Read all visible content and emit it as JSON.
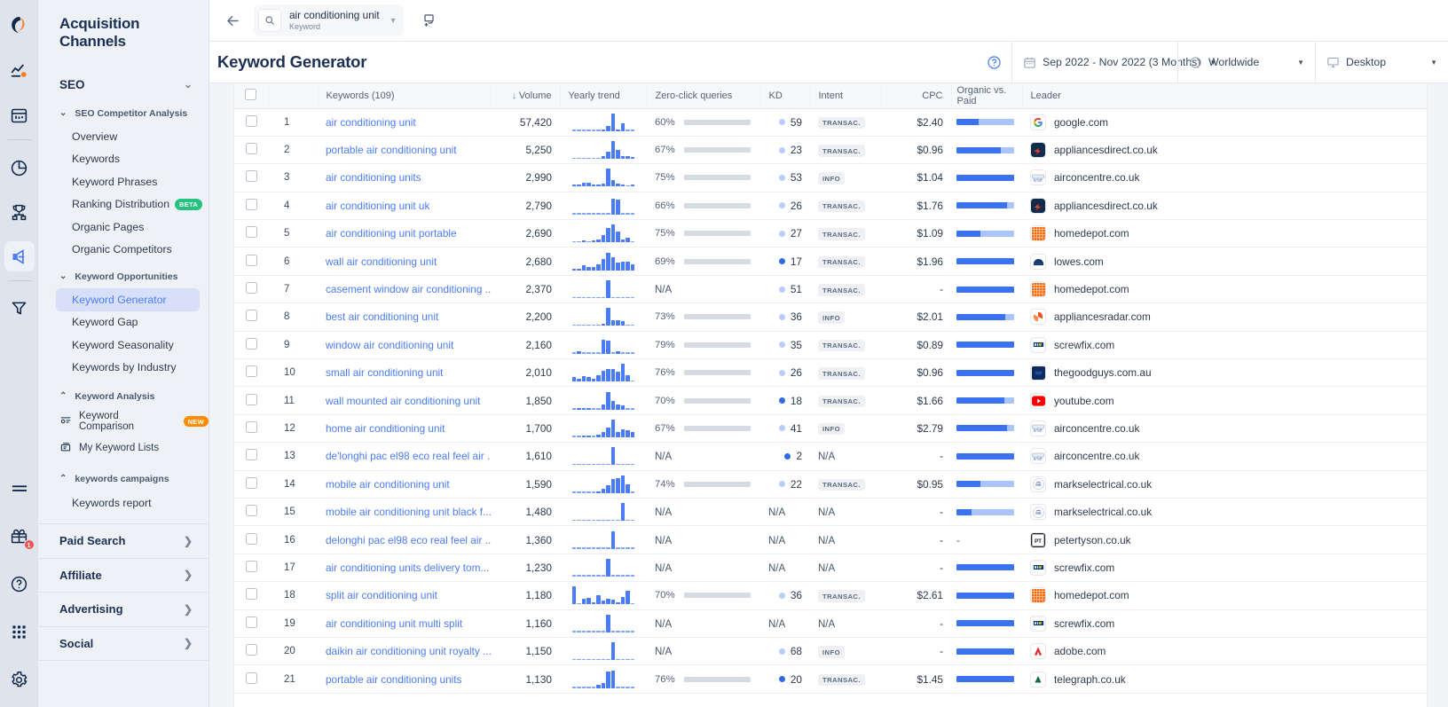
{
  "rail": {
    "items": [
      {
        "name": "logo-icon",
        "label": "Similarweb"
      },
      {
        "name": "trends-icon",
        "label": "Trends"
      },
      {
        "name": "website-analysis-icon",
        "label": "Website Analysis"
      },
      {
        "name": "market-research-icon",
        "label": "Market Research"
      },
      {
        "name": "benchmarking-icon",
        "label": "Benchmarking"
      },
      {
        "name": "acquisition-channels-icon",
        "label": "Acquisition Channels"
      },
      {
        "name": "funnel-icon",
        "label": "Funnel"
      },
      {
        "name": "menu-icon",
        "label": "Menu"
      },
      {
        "name": "gift-icon",
        "label": "What's New"
      },
      {
        "name": "help-icon",
        "label": "Help"
      },
      {
        "name": "apps-icon",
        "label": "Apps"
      },
      {
        "name": "settings-icon",
        "label": "Settings"
      }
    ],
    "gift_badge": "1"
  },
  "sidebar": {
    "title": "Acquisition Channels",
    "seo": {
      "label": "SEO"
    },
    "groups": [
      {
        "label": "SEO Competitor Analysis",
        "items": [
          {
            "label": "Overview"
          },
          {
            "label": "Keywords"
          },
          {
            "label": "Keyword Phrases"
          },
          {
            "label": "Ranking Distribution",
            "badge": "BETA",
            "badge_type": "beta"
          },
          {
            "label": "Organic Pages"
          },
          {
            "label": "Organic Competitors"
          }
        ]
      },
      {
        "label": "Keyword Opportunities",
        "items": [
          {
            "label": "Keyword Generator",
            "selected": true
          },
          {
            "label": "Keyword Gap"
          },
          {
            "label": "Keyword Seasonality"
          },
          {
            "label": "Keywords by Industry"
          }
        ]
      },
      {
        "label": "Keyword Analysis",
        "items": [
          {
            "label": "Keyword Comparison",
            "badge": "NEW",
            "badge_type": "new",
            "icon": "keyword-comparison-icon"
          },
          {
            "label": "My Keyword Lists",
            "icon": "keyword-lists-icon"
          }
        ]
      },
      {
        "label": "keywords campaigns",
        "items": [
          {
            "label": "Keywords report"
          }
        ]
      }
    ],
    "footer": [
      {
        "label": "Paid Search"
      },
      {
        "label": "Affiliate"
      },
      {
        "label": "Advertising"
      },
      {
        "label": "Social"
      }
    ]
  },
  "topbar": {
    "back": "back-arrow",
    "search_value": "air conditioning unit",
    "search_sublabel": "Keyword",
    "add_button": "add-comparison"
  },
  "header": {
    "title": "Keyword Generator",
    "help": "?",
    "date_range": "Sep 2022 - Nov 2022 (3 Months)",
    "location": "Worldwide",
    "device": "Desktop"
  },
  "table": {
    "columns": [
      {
        "key": "check",
        "label": ""
      },
      {
        "key": "rank",
        "label": ""
      },
      {
        "key": "keyword",
        "label": "Keywords (109)"
      },
      {
        "key": "volume",
        "label": "Volume",
        "sorted": true
      },
      {
        "key": "trend",
        "label": "Yearly trend"
      },
      {
        "key": "zero",
        "label": "Zero-click queries"
      },
      {
        "key": "kd",
        "label": "KD"
      },
      {
        "key": "intent",
        "label": "Intent"
      },
      {
        "key": "cpc",
        "label": "CPC"
      },
      {
        "key": "ovp",
        "label": "Organic vs. Paid"
      },
      {
        "key": "leader",
        "label": "Leader"
      }
    ],
    "rows": [
      {
        "rank": "1",
        "keyword": "air conditioning unit",
        "volume": "57,420",
        "trend": [
          0,
          0,
          0,
          0,
          0,
          0,
          8,
          30,
          100,
          5,
          45,
          0,
          0
        ],
        "zero": "60%",
        "zero_pct": 60,
        "kd": "59",
        "kd_hard": false,
        "intent": "TRANSAC.",
        "cpc": "$2.40",
        "organic": 38,
        "paid": 62,
        "leader": "google.com",
        "fav": "google"
      },
      {
        "rank": "2",
        "keyword": "portable air conditioning unit",
        "volume": "5,250",
        "trend": [
          0,
          0,
          0,
          0,
          0,
          0,
          14,
          38,
          100,
          48,
          16,
          14,
          7
        ],
        "zero": "67%",
        "zero_pct": 67,
        "kd": "23",
        "kd_hard": false,
        "intent": "TRANSAC.",
        "cpc": "$0.96",
        "organic": 77,
        "paid": 23,
        "leader": "appliancesdirect.co.uk",
        "fav": "appliancesdirect"
      },
      {
        "rank": "3",
        "keyword": "air conditioning units",
        "volume": "2,990",
        "trend": [
          12,
          10,
          22,
          22,
          14,
          14,
          18,
          100,
          38,
          16,
          14,
          0,
          10
        ],
        "zero": "75%",
        "zero_pct": 75,
        "kd": "53",
        "kd_hard": false,
        "intent": "INFO",
        "cpc": "$1.04",
        "organic": 100,
        "paid": 0,
        "leader": "airconcentre.co.uk",
        "fav": "airconcentre"
      },
      {
        "rank": "4",
        "keyword": "air conditioning unit uk",
        "volume": "2,790",
        "trend": [
          0,
          0,
          0,
          0,
          0,
          0,
          0,
          0,
          88,
          82,
          0,
          0,
          0
        ],
        "zero": "66%",
        "zero_pct": 66,
        "kd": "26",
        "kd_hard": false,
        "intent": "TRANSAC.",
        "cpc": "$1.76",
        "organic": 88,
        "paid": 12,
        "leader": "appliancesdirect.co.uk",
        "fav": "appliancesdirect"
      },
      {
        "rank": "5",
        "keyword": "air conditioning unit portable",
        "volume": "2,690",
        "trend": [
          0,
          0,
          7,
          0,
          12,
          16,
          40,
          80,
          100,
          62,
          14,
          26,
          0
        ],
        "zero": "75%",
        "zero_pct": 75,
        "kd": "27",
        "kd_hard": false,
        "intent": "TRANSAC.",
        "cpc": "$1.09",
        "organic": 41,
        "paid": 59,
        "leader": "homedepot.com",
        "fav": "homedepot"
      },
      {
        "rank": "6",
        "keyword": "wall air conditioning unit",
        "volume": "2,680",
        "trend": [
          6,
          10,
          26,
          16,
          18,
          34,
          62,
          100,
          74,
          42,
          50,
          46,
          34
        ],
        "zero": "69%",
        "zero_pct": 69,
        "kd": "17",
        "kd_hard": true,
        "intent": "TRANSAC.",
        "cpc": "$1.96",
        "organic": 100,
        "paid": 0,
        "leader": "lowes.com",
        "fav": "lowes"
      },
      {
        "rank": "7",
        "keyword": "casement window air conditioning ...",
        "volume": "2,370",
        "trend": [
          0,
          0,
          0,
          0,
          0,
          0,
          0,
          100,
          0,
          0,
          0,
          0,
          0
        ],
        "zero": "N/A",
        "zero_pct": 0,
        "kd": "51",
        "kd_hard": false,
        "intent": "TRANSAC.",
        "cpc": "-",
        "organic": 100,
        "paid": 0,
        "leader": "homedepot.com",
        "fav": "homedepot"
      },
      {
        "rank": "8",
        "keyword": "best air conditioning unit",
        "volume": "2,200",
        "trend": [
          0,
          0,
          0,
          0,
          0,
          0,
          12,
          100,
          34,
          30,
          28,
          0,
          0
        ],
        "zero": "73%",
        "zero_pct": 73,
        "kd": "36",
        "kd_hard": false,
        "intent": "INFO",
        "cpc": "$2.01",
        "organic": 85,
        "paid": 15,
        "leader": "appliancesradar.com",
        "fav": "appliancesradar"
      },
      {
        "rank": "9",
        "keyword": "window air conditioning unit",
        "volume": "2,160",
        "trend": [
          0,
          12,
          0,
          0,
          0,
          0,
          80,
          74,
          0,
          16,
          0,
          0,
          0
        ],
        "zero": "79%",
        "zero_pct": 79,
        "kd": "35",
        "kd_hard": false,
        "intent": "TRANSAC.",
        "cpc": "$0.89",
        "organic": 100,
        "paid": 0,
        "leader": "screwfix.com",
        "fav": "screwfix"
      },
      {
        "rank": "10",
        "keyword": "small air conditioning unit",
        "volume": "2,010",
        "trend": [
          24,
          16,
          30,
          26,
          16,
          34,
          60,
          72,
          70,
          54,
          100,
          34,
          0
        ],
        "zero": "76%",
        "zero_pct": 76,
        "kd": "26",
        "kd_hard": false,
        "intent": "TRANSAC.",
        "cpc": "$0.96",
        "organic": 100,
        "paid": 0,
        "leader": "thegoodguys.com.au",
        "fav": "thegoodguys"
      },
      {
        "rank": "11",
        "keyword": "wall mounted air conditioning unit",
        "volume": "1,850",
        "trend": [
          0,
          8,
          6,
          8,
          0,
          0,
          28,
          100,
          48,
          28,
          22,
          0,
          0
        ],
        "zero": "70%",
        "zero_pct": 70,
        "kd": "18",
        "kd_hard": true,
        "intent": "TRANSAC.",
        "cpc": "$1.66",
        "organic": 83,
        "paid": 17,
        "leader": "youtube.com",
        "fav": "youtube"
      },
      {
        "rank": "12",
        "keyword": "home air conditioning unit",
        "volume": "1,700",
        "trend": [
          0,
          0,
          10,
          12,
          0,
          16,
          32,
          56,
          100,
          32,
          46,
          40,
          28
        ],
        "zero": "67%",
        "zero_pct": 67,
        "kd": "41",
        "kd_hard": false,
        "intent": "INFO",
        "cpc": "$2.79",
        "organic": 88,
        "paid": 12,
        "leader": "airconcentre.co.uk",
        "fav": "airconcentre"
      },
      {
        "rank": "13",
        "keyword": "de'longhi pac el98 eco real feel air ...",
        "volume": "1,610",
        "trend": [
          0,
          0,
          0,
          0,
          0,
          0,
          0,
          0,
          100,
          0,
          0,
          0,
          0
        ],
        "zero": "N/A",
        "zero_pct": 0,
        "kd": "2",
        "kd_hard": true,
        "intent": "N/A",
        "cpc": "-",
        "organic": 100,
        "paid": 0,
        "leader": "airconcentre.co.uk",
        "fav": "airconcentre"
      },
      {
        "rank": "14",
        "keyword": "mobile air conditioning unit",
        "volume": "1,590",
        "trend": [
          0,
          0,
          0,
          0,
          0,
          10,
          22,
          42,
          78,
          82,
          100,
          50,
          0
        ],
        "zero": "74%",
        "zero_pct": 74,
        "kd": "22",
        "kd_hard": false,
        "intent": "TRANSAC.",
        "cpc": "$0.95",
        "organic": 41,
        "paid": 59,
        "leader": "markselectrical.co.uk",
        "fav": "markselectrical"
      },
      {
        "rank": "15",
        "keyword": "mobile air conditioning unit black f...",
        "volume": "1,480",
        "trend": [
          0,
          0,
          0,
          0,
          0,
          0,
          0,
          0,
          0,
          0,
          100,
          0,
          0
        ],
        "zero": "N/A",
        "zero_pct": 0,
        "kd": "N/A",
        "kd_hard": false,
        "intent": "N/A",
        "cpc": "-",
        "organic": 26,
        "paid": 74,
        "leader": "markselectrical.co.uk",
        "fav": "markselectrical"
      },
      {
        "rank": "16",
        "keyword": "delonghi pac el98 eco real feel air ...",
        "volume": "1,360",
        "trend": [
          0,
          0,
          0,
          0,
          0,
          0,
          0,
          0,
          100,
          0,
          0,
          0,
          0
        ],
        "zero": "N/A",
        "zero_pct": 0,
        "kd": "N/A",
        "kd_hard": false,
        "intent": "N/A",
        "cpc": "-",
        "organic": 0,
        "paid": 0,
        "leader": "petertyson.co.uk",
        "fav": "petertyson",
        "ovp_dash": true
      },
      {
        "rank": "17",
        "keyword": "air conditioning units delivery tom...",
        "volume": "1,230",
        "trend": [
          0,
          0,
          0,
          0,
          0,
          0,
          0,
          100,
          0,
          0,
          0,
          0,
          0
        ],
        "zero": "N/A",
        "zero_pct": 0,
        "kd": "N/A",
        "kd_hard": false,
        "intent": "N/A",
        "cpc": "-",
        "organic": 100,
        "paid": 0,
        "leader": "screwfix.com",
        "fav": "screwfix"
      },
      {
        "rank": "18",
        "keyword": "split air conditioning unit",
        "volume": "1,180",
        "trend": [
          100,
          0,
          30,
          36,
          14,
          52,
          20,
          34,
          26,
          14,
          44,
          78,
          0
        ],
        "zero": "70%",
        "zero_pct": 70,
        "kd": "36",
        "kd_hard": false,
        "intent": "TRANSAC.",
        "cpc": "$2.61",
        "organic": 100,
        "paid": 0,
        "leader": "homedepot.com",
        "fav": "homedepot"
      },
      {
        "rank": "19",
        "keyword": "air conditioning unit multi split",
        "volume": "1,160",
        "trend": [
          0,
          0,
          0,
          0,
          0,
          0,
          0,
          100,
          0,
          0,
          0,
          0,
          0
        ],
        "zero": "N/A",
        "zero_pct": 0,
        "kd": "N/A",
        "kd_hard": false,
        "intent": "N/A",
        "cpc": "-",
        "organic": 100,
        "paid": 0,
        "leader": "screwfix.com",
        "fav": "screwfix"
      },
      {
        "rank": "20",
        "keyword": "daikin air conditioning unit royalty ...",
        "volume": "1,150",
        "trend": [
          0,
          0,
          0,
          0,
          0,
          0,
          0,
          0,
          100,
          0,
          0,
          0,
          0
        ],
        "zero": "N/A",
        "zero_pct": 0,
        "kd": "68",
        "kd_hard": false,
        "intent": "INFO",
        "cpc": "-",
        "organic": 100,
        "paid": 0,
        "leader": "adobe.com",
        "fav": "adobe"
      },
      {
        "rank": "21",
        "keyword": "portable air conditioning units",
        "volume": "1,130",
        "trend": [
          0,
          0,
          0,
          0,
          0,
          20,
          28,
          92,
          100,
          0,
          0,
          0,
          0
        ],
        "zero": "76%",
        "zero_pct": 76,
        "kd": "20",
        "kd_hard": true,
        "intent": "TRANSAC.",
        "cpc": "$1.45",
        "organic": 100,
        "paid": 0,
        "leader": "telegraph.co.uk",
        "fav": "telegraph"
      }
    ]
  },
  "colors": {
    "accent": "#4a7cf5",
    "organic": "#3b72ef",
    "paid": "#a9c5fb",
    "beta": "#25c281",
    "new": "#fb8c00",
    "dark": "#1c3055"
  }
}
